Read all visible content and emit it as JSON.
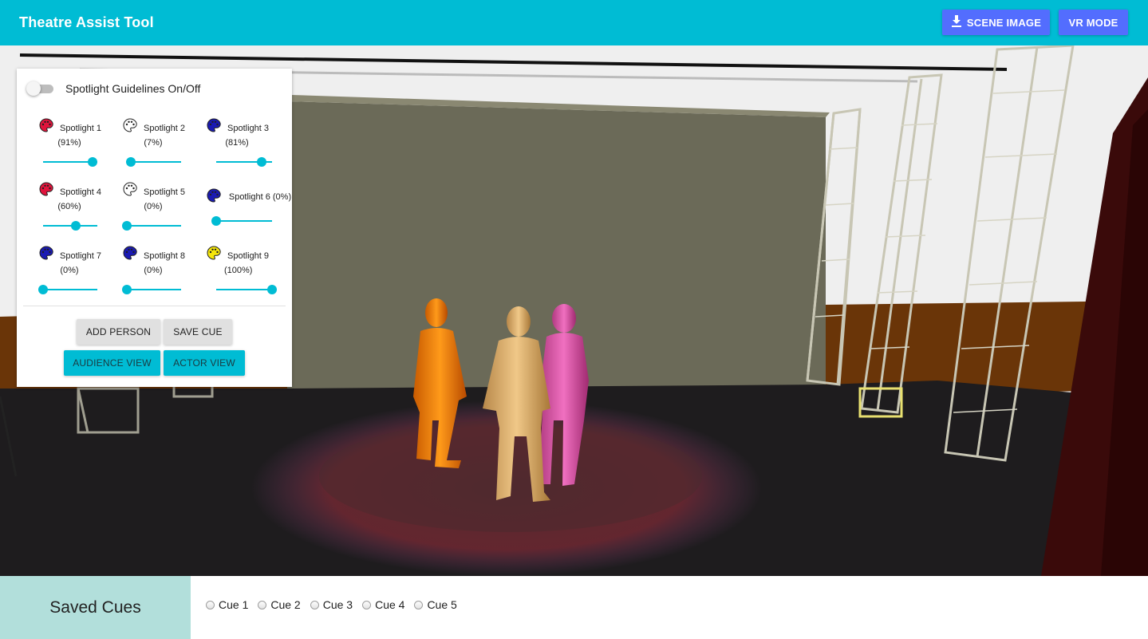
{
  "app": {
    "title": "Theatre Assist Tool",
    "scene_image_label": "SCENE IMAGE",
    "vr_mode_label": "VR MODE",
    "download_icon": "download-icon"
  },
  "panel": {
    "toggle_label": "Spotlight Guidelines On/Off",
    "toggle_on": false,
    "spotlights": [
      {
        "name": "Spotlight 1",
        "pct": "(91%)",
        "value": 0.91,
        "color": "#e0143c"
      },
      {
        "name": "Spotlight 2",
        "pct": "(7%)",
        "value": 0.07,
        "color": "#ffffff"
      },
      {
        "name": "Spotlight 3",
        "pct": "(81%)",
        "value": 0.81,
        "color": "#1a1ab4"
      },
      {
        "name": "Spotlight 4",
        "pct": "(60%)",
        "value": 0.6,
        "color": "#e0143c"
      },
      {
        "name": "Spotlight 5",
        "pct": "(0%)",
        "value": 0.0,
        "color": "#ffffff"
      },
      {
        "name": "Spotlight 6 (0%)",
        "pct": "",
        "value": 0.0,
        "color": "#1a1ab4"
      },
      {
        "name": "Spotlight 7",
        "pct": "(0%)",
        "value": 0.0,
        "color": "#1a1ab4"
      },
      {
        "name": "Spotlight 8",
        "pct": "(0%)",
        "value": 0.0,
        "color": "#1a1ab4"
      },
      {
        "name": "Spotlight 9",
        "pct": "(100%)",
        "value": 1.0,
        "color": "#f5e60a"
      }
    ],
    "add_person_label": "ADD PERSON",
    "save_cue_label": "SAVE CUE",
    "audience_view_label": "AUDIENCE VIEW",
    "actor_view_label": "ACTOR VIEW"
  },
  "cues": {
    "heading": "Saved Cues",
    "items": [
      "Cue 1",
      "Cue 2",
      "Cue 3",
      "Cue 4",
      "Cue 5"
    ]
  },
  "colors": {
    "primary": "#00bcd4",
    "accent": "#536dfe",
    "cue_header": "#b2dfdb"
  }
}
